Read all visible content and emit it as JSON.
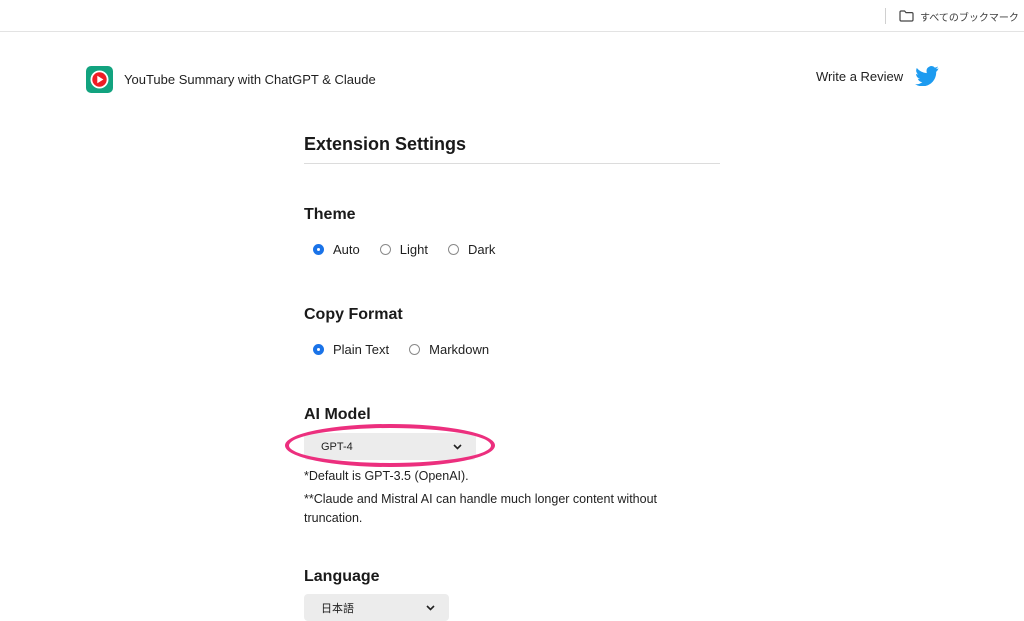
{
  "bookmarks_bar": {
    "all_bookmarks_label": "すべてのブックマーク",
    "folder_icon": "folder-icon"
  },
  "header": {
    "extension_title": "YouTube Summary with ChatGPT & Claude",
    "logo_icon": "youtube-play-icon",
    "review_label": "Write a Review",
    "review_icon": "twitter-bird-icon",
    "brand_color": "#12a37f",
    "twitter_color": "#1d9bf0"
  },
  "settings": {
    "title": "Extension Settings",
    "theme": {
      "heading": "Theme",
      "options": [
        "Auto",
        "Light",
        "Dark"
      ],
      "selected": "Auto"
    },
    "copy_format": {
      "heading": "Copy Format",
      "options": [
        "Plain Text",
        "Markdown"
      ],
      "selected": "Plain Text"
    },
    "ai_model": {
      "heading": "AI Model",
      "selected_value": "GPT-4",
      "note_1": "*Default is GPT-3.5 (OpenAI).",
      "note_2": "**Claude and Mistral AI can handle much longer content without truncation."
    },
    "language": {
      "heading": "Language",
      "selected_value": "日本語"
    }
  },
  "annotation": {
    "highlight_color": "#ec2f7e"
  }
}
